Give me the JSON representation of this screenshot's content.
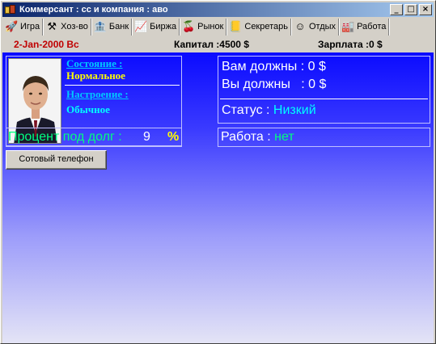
{
  "window": {
    "title": "Коммерсант : сс и компания : аво",
    "controls": {
      "minimize": "_",
      "maximize": "□",
      "close": "×"
    }
  },
  "toolbar": [
    {
      "label": "Игра",
      "icon": "rocket-icon",
      "glyph": "🚀"
    },
    {
      "label": "Хоз-во",
      "icon": "household-icon",
      "glyph": "⚒"
    },
    {
      "label": "Банк",
      "icon": "bank-icon",
      "glyph": "🏦"
    },
    {
      "label": "Биржа",
      "icon": "exchange-icon",
      "glyph": "📈"
    },
    {
      "label": "Рынок",
      "icon": "market-icon",
      "glyph": "🍒"
    },
    {
      "label": "Секретарь",
      "icon": "secretary-icon",
      "glyph": "📒"
    },
    {
      "label": "Отдых",
      "icon": "smiley-icon",
      "glyph": "☺"
    },
    {
      "label": "Работа",
      "icon": "work-icon",
      "glyph": "🏭"
    }
  ],
  "statusbar": {
    "date": "2-Jan-2000 Вс",
    "capital": "Капитал :4500 $",
    "salary": "Зарплата :0 $"
  },
  "player": {
    "condition_label": "Состояние :",
    "condition_value": "Нормальное",
    "mood_label": "Настроение :",
    "mood_value": "Обычное"
  },
  "debts": {
    "owed_to_you": "Вам должны : 0 $",
    "you_owe": "Вы должны   : 0 $",
    "status_label": "Статус : ",
    "status_value": "Низкий"
  },
  "interest": {
    "label": "Процент под долг :",
    "value": "9",
    "unit": "%"
  },
  "job": {
    "label": "Работа : ",
    "value": "нет"
  },
  "phone_button": "Сотовый телефон",
  "colors": {
    "label_cyan": "#00c8ff",
    "value_yellow": "#ffff00",
    "value_cyan": "#00ffff",
    "green": "#00ff80",
    "date_red": "#c00000"
  }
}
